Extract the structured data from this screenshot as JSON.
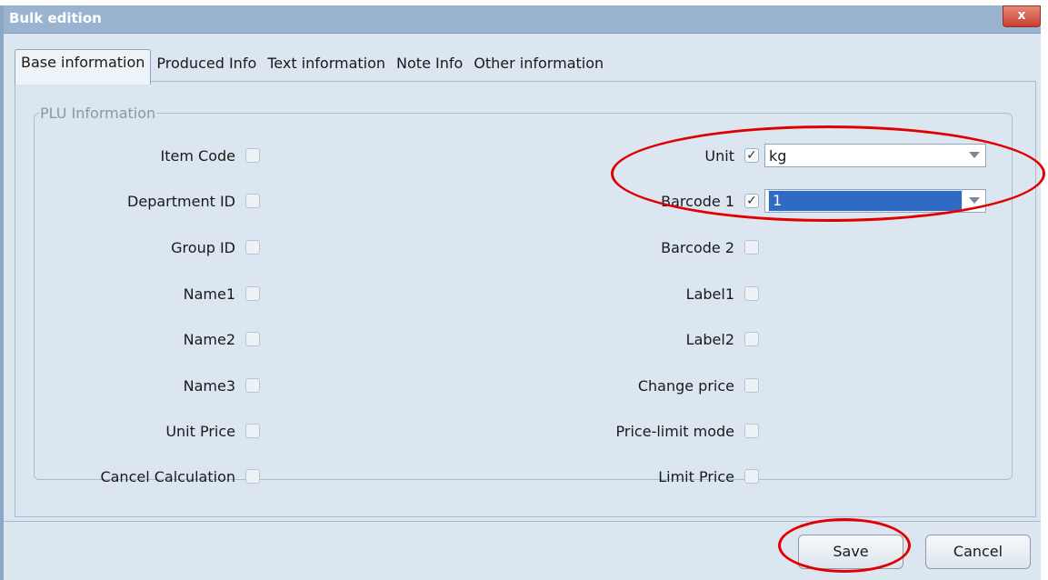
{
  "window": {
    "title": "Bulk edition",
    "close_label": "x"
  },
  "tabs": [
    {
      "label": "Base information",
      "active": true
    },
    {
      "label": "Produced Info"
    },
    {
      "label": "Text information"
    },
    {
      "label": "Note Info"
    },
    {
      "label": "Other information"
    }
  ],
  "group": {
    "title": "PLU Information"
  },
  "left_fields": [
    {
      "label": "Item Code",
      "checked": false
    },
    {
      "label": "Department ID",
      "checked": false
    },
    {
      "label": "Group ID",
      "checked": false
    },
    {
      "label": "Name1",
      "checked": false
    },
    {
      "label": "Name2",
      "checked": false
    },
    {
      "label": "Name3",
      "checked": false
    },
    {
      "label": "Unit Price",
      "checked": false
    },
    {
      "label": "Cancel Calculation",
      "checked": false
    }
  ],
  "right_fields": [
    {
      "label": "Unit",
      "checked": true,
      "value": "kg"
    },
    {
      "label": "Barcode 1",
      "checked": true,
      "value": "1"
    },
    {
      "label": "Barcode 2",
      "checked": false
    },
    {
      "label": "Label1",
      "checked": false
    },
    {
      "label": "Label2",
      "checked": false
    },
    {
      "label": "Change price",
      "checked": false
    },
    {
      "label": "Price-limit mode",
      "checked": false
    },
    {
      "label": "Limit Price",
      "checked": false
    }
  ],
  "check_mark": "✓",
  "buttons": {
    "save": "Save",
    "cancel": "Cancel"
  },
  "colors": {
    "annotation": "#e00000",
    "selection": "#316ac5",
    "titlebar": "#9ab4cf"
  }
}
